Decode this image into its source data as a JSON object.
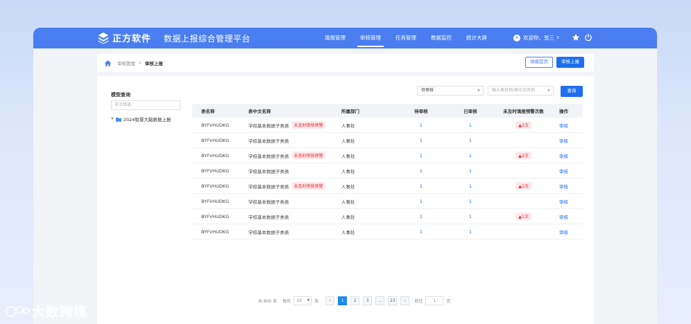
{
  "brand": {
    "name": "正方软件",
    "platform_title": "数据上报综合管理平台"
  },
  "nav": [
    "填报管理",
    "审核管理",
    "任务管理",
    "数据监控",
    "统计大屏"
  ],
  "user": {
    "greeting": "欢迎你、张三",
    "avatar": "A"
  },
  "breadcrumb": {
    "parent": "审核管理",
    "current": "审核上报"
  },
  "actions": {
    "home_btn": "填报首页",
    "review_btn": "审核上报"
  },
  "sidebar": {
    "title": "模型查询",
    "search_placeholder": "节点筛选",
    "tree": [
      {
        "label": "2024智慧大脑数据上报"
      }
    ]
  },
  "filters": {
    "status_value": "待审核",
    "name_placeholder": "输入表名称/表中文名称",
    "query_btn": "查询"
  },
  "table": {
    "columns": [
      "表名称",
      "表中文名称",
      "所属部门",
      "待审核",
      "已审核",
      "未及时填报预警次数",
      "操作"
    ],
    "rows": [
      {
        "name": "BYFVHUDKG",
        "cn": "学校基本数据子类表",
        "warn": "未及时审核预警",
        "dept": "人事处",
        "pending": "1",
        "done": "1",
        "count": "2次",
        "op": "审核"
      },
      {
        "name": "BYFVHUDKG",
        "cn": "学校基本数据子类表",
        "warn": "",
        "dept": "人事处",
        "pending": "1",
        "done": "1",
        "count": "",
        "op": "审核"
      },
      {
        "name": "BYFVHUDKG",
        "cn": "学校基本数据子类表",
        "warn": "未及时审核预警",
        "dept": "人事处",
        "pending": "1",
        "done": "1",
        "count": "2次",
        "op": "审核"
      },
      {
        "name": "BYFVHUDKG",
        "cn": "学校基本数据子类表",
        "warn": "",
        "dept": "人事处",
        "pending": "1",
        "done": "1",
        "count": "",
        "op": "审核"
      },
      {
        "name": "BYFVHUDKG",
        "cn": "学校基本数据子类表",
        "warn": "未及时审核预警",
        "dept": "人事处",
        "pending": "1",
        "done": "1",
        "count": "2次",
        "op": "审核"
      },
      {
        "name": "BYFVHUDKG",
        "cn": "学校基本数据子类表",
        "warn": "",
        "dept": "人事处",
        "pending": "1",
        "done": "1",
        "count": "",
        "op": "审核"
      },
      {
        "name": "BYFVHUDKG",
        "cn": "学校基本数据子类表",
        "warn": "",
        "dept": "人事处",
        "pending": "1",
        "done": "1",
        "count": "1次",
        "op": "审核"
      },
      {
        "name": "BYFVHUDKG",
        "cn": "学校基本数据子类表",
        "warn": "",
        "dept": "人事处",
        "pending": "1",
        "done": "1",
        "count": "",
        "op": "审核"
      }
    ]
  },
  "pagination": {
    "total": "共 800 条",
    "per_page_label": "每页",
    "per_page": "10",
    "unit": "条",
    "pages": [
      "1",
      "2",
      "3",
      "...",
      "23"
    ],
    "goto_label": "前往",
    "goto_value": "1",
    "page_unit": "页"
  },
  "watermark": "大数跨境",
  "colors": {
    "primary": "#4a7ef0",
    "accent": "#1e6ff0",
    "warn": "#e0303e"
  }
}
